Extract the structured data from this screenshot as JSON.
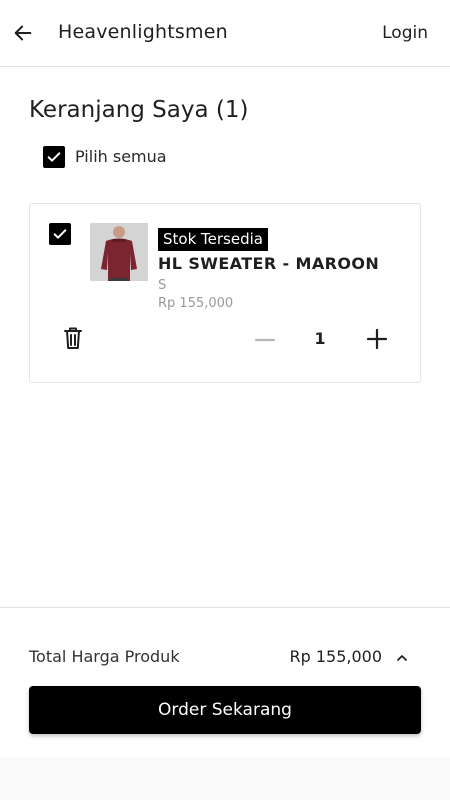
{
  "header": {
    "brand": "Heavenlightsmen",
    "login_label": "Login",
    "back_icon": "arrow-left-icon"
  },
  "cart": {
    "title": "Keranjang Saya (1)",
    "select_all_label": "Pilih semua",
    "select_all_checked": true,
    "items": [
      {
        "checked": true,
        "stock_badge": "Stok Tersedia",
        "name": "HL SWEATER - MAROON",
        "size": "S",
        "price": "Rp 155,000",
        "quantity": "1",
        "image_icon": "maroon-sweater-photo"
      }
    ]
  },
  "footer": {
    "total_label": "Total Harga Produk",
    "total_value": "Rp 155,000",
    "order_button_label": "Order Sekarang"
  },
  "colors": {
    "accent": "#000000",
    "product_maroon": "#7a2530",
    "muted_text": "#9a9a9a",
    "border": "#e3e3e3"
  }
}
